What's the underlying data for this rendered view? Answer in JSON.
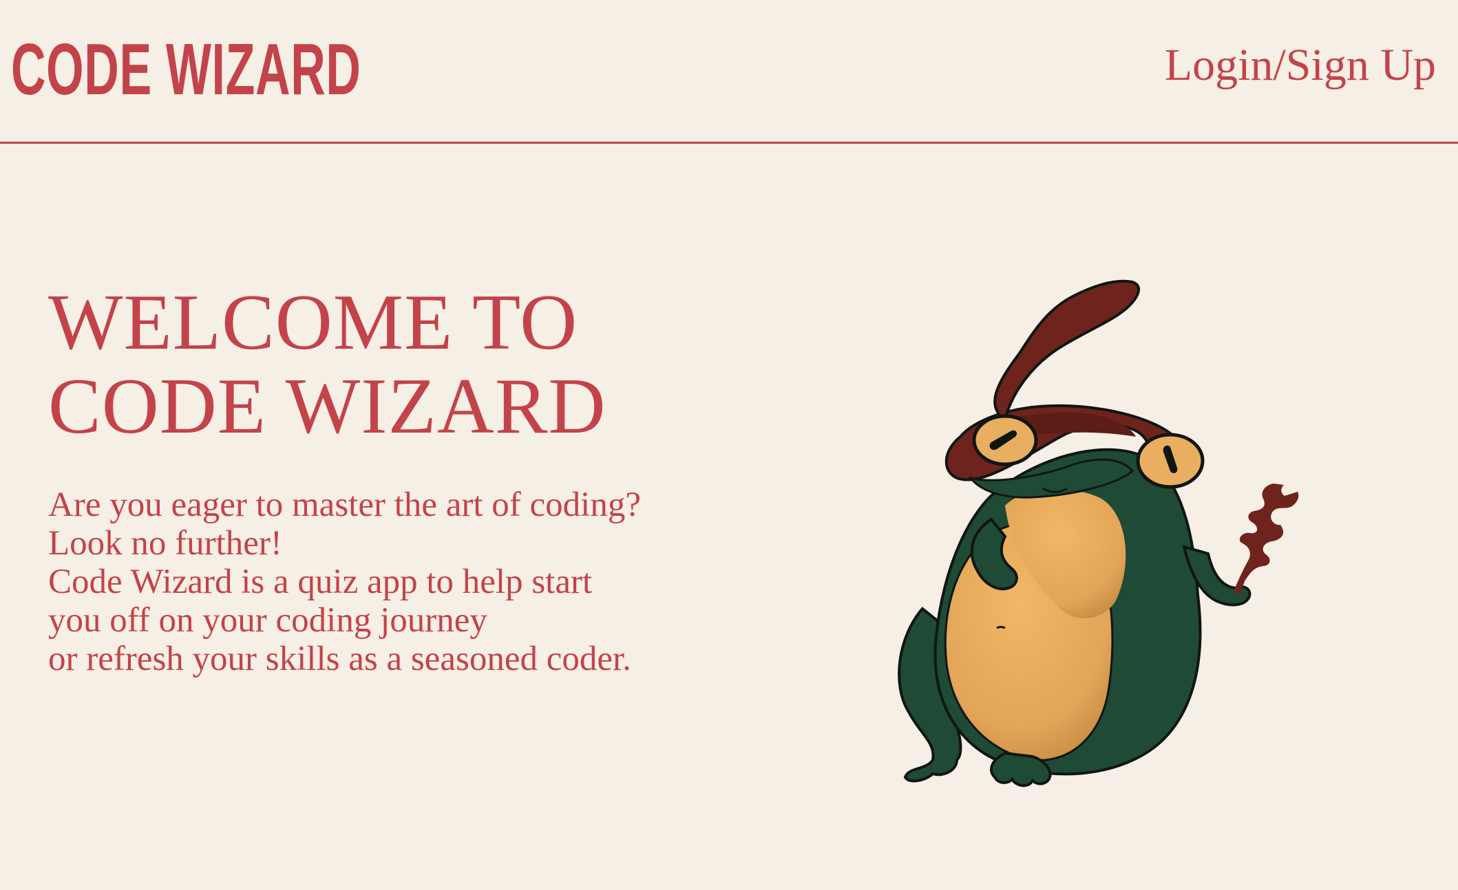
{
  "header": {
    "logo": "CODE WIZARD",
    "login_label": "Login/Sign Up"
  },
  "hero": {
    "title_lines": [
      "WELCOME TO",
      "CODE WIZARD"
    ],
    "description_lines": [
      "Are you eager to master the art of coding?",
      "Look no further!",
      "Code Wizard is a quiz app to help start",
      "you off on your coding journey",
      "or refresh your skills as a seasoned coder."
    ]
  },
  "mascot": {
    "icon": "wizard-frog-illustration"
  },
  "colors": {
    "background": "#f5efe5",
    "accent": "#c3434a",
    "frog_green": "#1f4a36",
    "belly": "#e9ae60",
    "hat": "#6e241c"
  }
}
